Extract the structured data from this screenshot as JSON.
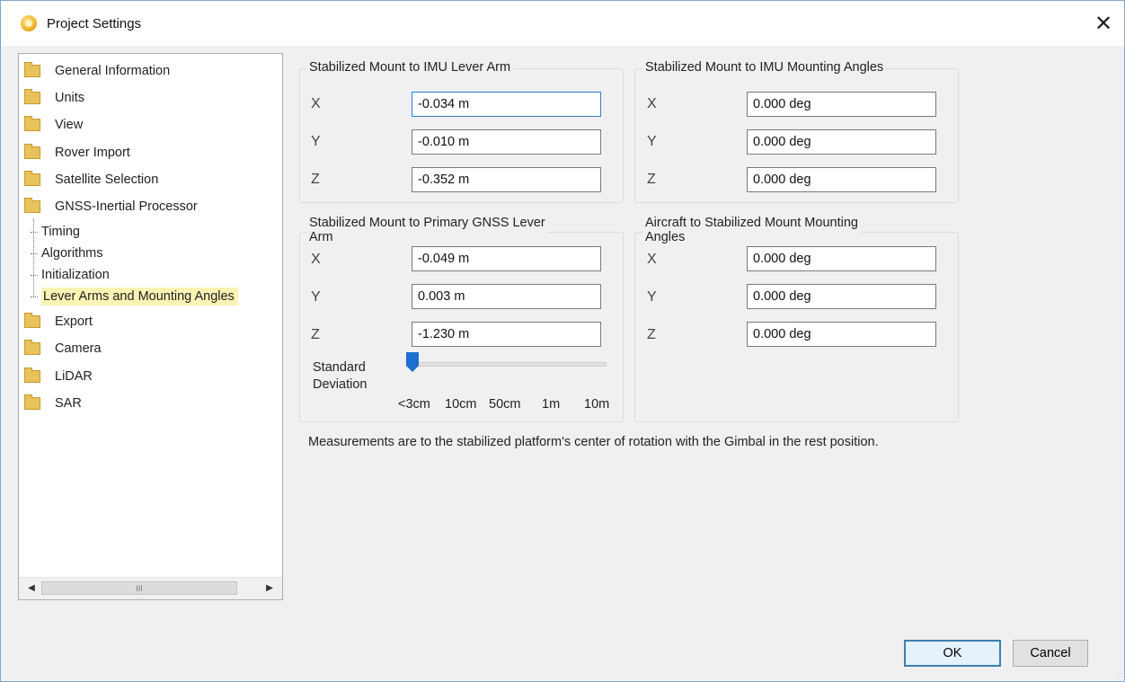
{
  "window": {
    "title": "Project Settings",
    "close_glyph": "✕"
  },
  "tree": {
    "items": [
      {
        "label": "General Information",
        "icon": "folder-icon"
      },
      {
        "label": "Units",
        "icon": "folder-icon"
      },
      {
        "label": "View",
        "icon": "folder-icon"
      },
      {
        "label": "Rover Import",
        "icon": "folder-icon"
      },
      {
        "label": "Satellite Selection",
        "icon": "folder-icon"
      },
      {
        "label": "GNSS-Inertial Processor",
        "icon": "folder-icon"
      },
      {
        "label": "Export",
        "icon": "folder-icon"
      },
      {
        "label": "Camera",
        "icon": "folder-icon"
      },
      {
        "label": "LiDAR",
        "icon": "folder-icon"
      },
      {
        "label": "SAR",
        "icon": "folder-icon"
      }
    ],
    "children": [
      {
        "label": "Timing"
      },
      {
        "label": "Algorithms"
      },
      {
        "label": "Initialization"
      },
      {
        "label": "Lever Arms and Mounting Angles",
        "selected": true
      }
    ],
    "scroll_thumb_glyph": "III",
    "scroll_left": "◀",
    "scroll_right": "▶"
  },
  "imu_lever": {
    "title": "Stabilized Mount to IMU Lever Arm",
    "x_label": "X",
    "x": "-0.034 m",
    "y_label": "Y",
    "y": "-0.010 m",
    "z_label": "Z",
    "z": "-0.352 m"
  },
  "imu_angles": {
    "title": "Stabilized Mount to IMU Mounting Angles",
    "x_label": "X",
    "x": "0.000 deg",
    "y_label": "Y",
    "y": "0.000 deg",
    "z_label": "Z",
    "z": "0.000 deg"
  },
  "gnss_lever": {
    "title_line1": "Stabilized Mount to Primary GNSS Lever",
    "title_line2": "Arm",
    "x_label": "X",
    "x": "-0.049 m",
    "y_label": "Y",
    "y": "0.003 m",
    "z_label": "Z",
    "z": "-1.230 m",
    "std_label_1": "Standard",
    "std_label_2": "Deviation",
    "slider_value": "<3cm",
    "ticks": [
      "<3cm",
      "10cm",
      "50cm",
      "1m",
      "10m"
    ]
  },
  "aircraft_angles": {
    "title_line1": "Aircraft to Stabilized Mount Mounting",
    "title_line2": "Angles",
    "x_label": "X",
    "x": "0.000 deg",
    "y_label": "Y",
    "y": "0.000 deg",
    "z_label": "Z",
    "z": "0.000 deg"
  },
  "note": "Measurements are to the stabilized platform's center of rotation with the Gimbal in the rest position.",
  "buttons": {
    "ok": "OK",
    "cancel": "Cancel"
  }
}
